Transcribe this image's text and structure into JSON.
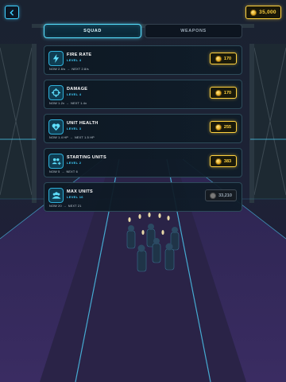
{
  "hud": {
    "coins": "35,000"
  },
  "tabs": [
    {
      "label": "SQUAD",
      "active": true
    },
    {
      "label": "WEAPONS",
      "active": false
    }
  ],
  "upgrades": [
    {
      "title": "FIRE RATE",
      "level": "LEVEL 4",
      "now": "NOW 2.6/s",
      "next": "NEXT 2.8/s",
      "price": "170",
      "affordable": true,
      "icon": "bolt-icon"
    },
    {
      "title": "DAMAGE",
      "level": "LEVEL 4",
      "now": "NOW 1.2x",
      "next": "NEXT 1.4x",
      "price": "170",
      "affordable": true,
      "icon": "crosshair-icon"
    },
    {
      "title": "UNIT HEALTH",
      "level": "LEVEL 3",
      "now": "NOW 1.4 HP",
      "next": "NEXT 1.5 HP",
      "price": "255",
      "affordable": true,
      "icon": "heart-plus-icon"
    },
    {
      "title": "STARTING UNITS",
      "level": "LEVEL 2",
      "now": "NOW 5",
      "next": "NEXT 6",
      "price": "383",
      "affordable": true,
      "icon": "group-plus-icon"
    },
    {
      "title": "MAX UNITS",
      "level": "LEVEL 16",
      "now": "NOW 20",
      "next": "NEXT 21",
      "price": "33,210",
      "affordable": false,
      "icon": "group-icon"
    }
  ],
  "colors": {
    "accent": "#3fd0ff",
    "gold": "#ffd23f",
    "panel": "#0d1823",
    "track": "#6a4aa8"
  }
}
